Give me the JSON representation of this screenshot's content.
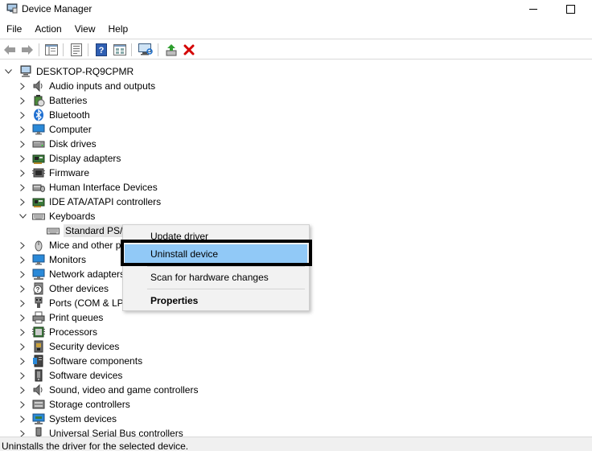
{
  "window": {
    "title": "Device Manager"
  },
  "menu": [
    {
      "id": "file",
      "label": "File"
    },
    {
      "id": "action",
      "label": "Action"
    },
    {
      "id": "view",
      "label": "View"
    },
    {
      "id": "help",
      "label": "Help"
    }
  ],
  "toolbar": {
    "buttons": [
      "back-icon",
      "forward-icon",
      "show-hide-console-tree-icon",
      "properties-icon",
      "help-icon",
      "view-icon",
      "scan-hardware-icon",
      "update-driver-icon",
      "uninstall-icon"
    ],
    "uninstall_color": "#d40000",
    "update_color": "#2e9d2e"
  },
  "tree": {
    "root": "DESKTOP-RQ9CPMR",
    "categories": [
      {
        "label": "Audio inputs and outputs",
        "icon": "speaker-icon",
        "expanded": false
      },
      {
        "label": "Batteries",
        "icon": "battery-icon",
        "expanded": false
      },
      {
        "label": "Bluetooth",
        "icon": "bluetooth-icon",
        "expanded": false
      },
      {
        "label": "Computer",
        "icon": "monitor-icon",
        "expanded": false
      },
      {
        "label": "Disk drives",
        "icon": "disk-icon",
        "expanded": false
      },
      {
        "label": "Display adapters",
        "icon": "display-adapter-icon",
        "expanded": false
      },
      {
        "label": "Firmware",
        "icon": "firmware-icon",
        "expanded": false
      },
      {
        "label": "Human Interface Devices",
        "icon": "hid-icon",
        "expanded": false
      },
      {
        "label": "IDE ATA/ATAPI controllers",
        "icon": "ide-controller-icon",
        "expanded": false
      },
      {
        "label": "Keyboards",
        "icon": "keyboard-icon",
        "expanded": true
      },
      {
        "label": "Mice and other p",
        "icon": "mouse-icon",
        "expanded": false
      },
      {
        "label": "Monitors",
        "icon": "monitor-icon",
        "expanded": false
      },
      {
        "label": "Network adapters",
        "icon": "network-icon",
        "expanded": false
      },
      {
        "label": "Other devices",
        "icon": "unknown-device-icon",
        "expanded": false
      },
      {
        "label": "Ports (COM & LP",
        "icon": "port-icon",
        "expanded": false
      },
      {
        "label": "Print queues",
        "icon": "printer-icon",
        "expanded": false
      },
      {
        "label": "Processors",
        "icon": "processor-icon",
        "expanded": false
      },
      {
        "label": "Security devices",
        "icon": "security-icon",
        "expanded": false
      },
      {
        "label": "Software components",
        "icon": "software-component-icon",
        "expanded": false
      },
      {
        "label": "Software devices",
        "icon": "software-device-icon",
        "expanded": false
      },
      {
        "label": "Sound, video and game controllers",
        "icon": "speaker-icon",
        "expanded": false
      },
      {
        "label": "Storage controllers",
        "icon": "storage-icon",
        "expanded": false
      },
      {
        "label": "System devices",
        "icon": "system-icon",
        "expanded": false
      },
      {
        "label": "Universal Serial Bus controllers",
        "icon": "usb-icon",
        "expanded": false
      }
    ],
    "keyboard_child": "Standard PS/2"
  },
  "context_menu": {
    "items": [
      {
        "label": "Update driver",
        "highlighted": false,
        "bold": false
      },
      {
        "label": "Uninstall device",
        "highlighted": true,
        "bold": false
      },
      {
        "label": "Scan for hardware changes",
        "highlighted": false,
        "bold": false
      },
      {
        "label": "Properties",
        "highlighted": false,
        "bold": true
      }
    ],
    "highlight_color": "#91c9f7"
  },
  "status": {
    "text": "Uninstalls the driver for the selected device."
  }
}
